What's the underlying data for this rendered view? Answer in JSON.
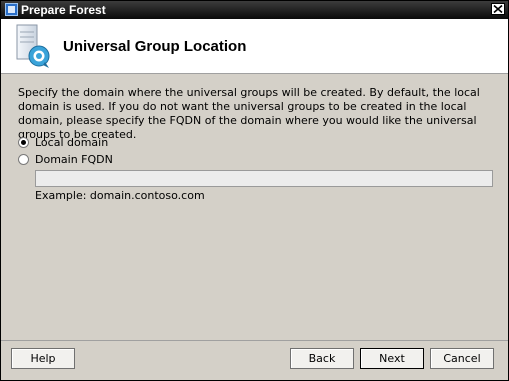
{
  "window": {
    "title": "Prepare Forest",
    "close_label": "×"
  },
  "header": {
    "title": "Universal Group Location"
  },
  "content": {
    "description": "Specify the domain where the universal groups will be created. By default, the local domain is used. If you do not want the universal groups to be created in the local domain, please specify the FQDN of the domain where you would like the universal groups to be created.",
    "options": [
      {
        "label": "Local domain",
        "checked": true
      },
      {
        "label": "Domain FQDN",
        "checked": false
      }
    ],
    "fqdn_value": "",
    "example": "Example: domain.contoso.com"
  },
  "footer": {
    "help": "Help",
    "back": "Back",
    "next": "Next",
    "cancel": "Cancel"
  }
}
